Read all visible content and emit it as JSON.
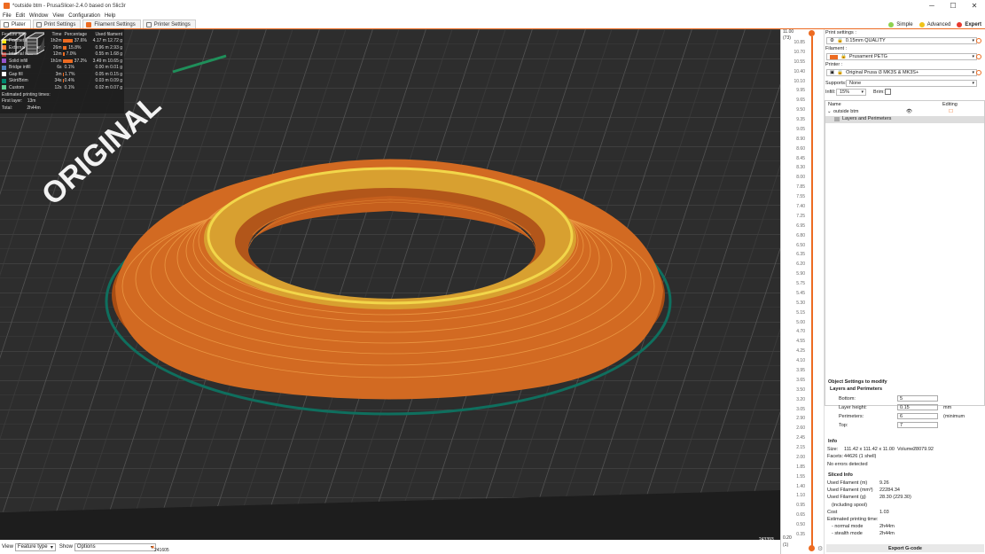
{
  "window": {
    "title": "*outside btm - PrusaSlicer-2.4.0 based on Slic3r",
    "controls": [
      "─",
      "☐",
      "✕"
    ]
  },
  "menu": [
    "File",
    "Edit",
    "Window",
    "View",
    "Configuration",
    "Help"
  ],
  "tabs": [
    {
      "label": "Plater"
    },
    {
      "label": "Print Settings"
    },
    {
      "label": "Filament Settings"
    },
    {
      "label": "Printer Settings"
    }
  ],
  "modes": [
    {
      "label": "Simple",
      "color": "#8fd14f"
    },
    {
      "label": "Advanced",
      "color": "#f0c419"
    },
    {
      "label": "Expert",
      "color": "#e83a2f"
    }
  ],
  "bed_text": "ORIGINAL",
  "legend": {
    "headers": [
      "Feature type",
      "Time",
      "Percentage",
      "Used filament"
    ],
    "rows": [
      {
        "name": "Perimeter",
        "time": "1h2m",
        "pct": "37.6%",
        "pct_value": 37.6,
        "used": "4.17 m  12.72 g",
        "color": "#ffe600"
      },
      {
        "name": "External perimeter",
        "time": "26m",
        "pct": "15.8%",
        "pct_value": 15.8,
        "used": "0.96 m  2.93 g",
        "color": "#ff7d38"
      },
      {
        "name": "Internal infill",
        "time": "12m",
        "pct": "7.0%",
        "pct_value": 7.0,
        "used": "0.55 m  1.68 g",
        "color": "#b03029"
      },
      {
        "name": "Solid infill",
        "time": "1h1m",
        "pct": "37.2%",
        "pct_value": 37.2,
        "used": "3.49 m  10.65 g",
        "color": "#9654cc"
      },
      {
        "name": "Bridge infill",
        "time": "6s",
        "pct": "0.1%",
        "pct_value": 0.1,
        "used": "0.00 m  0.01 g",
        "color": "#4d80ba"
      },
      {
        "name": "Gap fill",
        "time": "3m",
        "pct": "1.7%",
        "pct_value": 1.7,
        "used": "0.05 m  0.15 g",
        "color": "#ffffff"
      },
      {
        "name": "Skirt/Brim",
        "time": "34s",
        "pct": "0.4%",
        "pct_value": 0.4,
        "used": "0.03 m  0.09 g",
        "color": "#00876e"
      },
      {
        "name": "Custom",
        "time": "12s",
        "pct": "0.1%",
        "pct_value": 0.1,
        "used": "0.02 m  0.07 g",
        "color": "#5ed194"
      }
    ],
    "est_title": "Estimated printing times:",
    "first_layer_label": "First layer:",
    "first_layer": "13m",
    "total_label": "Total:",
    "total": "2h44m"
  },
  "bottom": {
    "view_label": "View",
    "view_value": "Feature type",
    "show_label": "Show",
    "show_value": "Options"
  },
  "hslider": {
    "left_value": "241605",
    "right_value": "243393"
  },
  "vslider": {
    "top_value": "11.00",
    "top_layer": "(73)",
    "bottom_value": "0.20",
    "bottom_layer": "(1)",
    "ticks": [
      "10.85",
      "10.70",
      "10.55",
      "10.40",
      "10.10",
      "9.95",
      "9.65",
      "9.50",
      "9.35",
      "9.05",
      "8.90",
      "8.60",
      "8.45",
      "8.30",
      "8.00",
      "7.85",
      "7.55",
      "7.40",
      "7.25",
      "6.95",
      "6.80",
      "6.50",
      "6.35",
      "6.20",
      "5.90",
      "5.75",
      "5.45",
      "5.30",
      "5.15",
      "5.00",
      "4.70",
      "4.55",
      "4.25",
      "4.10",
      "3.95",
      "3.65",
      "3.50",
      "3.20",
      "3.05",
      "2.90",
      "2.60",
      "2.45",
      "2.15",
      "2.00",
      "1.85",
      "1.55",
      "1.40",
      "1.10",
      "0.95",
      "0.65",
      "0.50",
      "0.35"
    ]
  },
  "panel": {
    "print_settings_label": "Print settings :",
    "print_settings_value": "0.15mm QUALITY",
    "filament_label": "Filament :",
    "filament_value": "Prusament PETG",
    "printer_label": "Printer :",
    "printer_value": "Original Prusa i3 MK3S & MK3S+",
    "supports_label": "Supports:",
    "supports_value": "None",
    "infill_label": "Infill:",
    "infill_value": "15%",
    "brim_label": "Brim:",
    "list_col_name": "Name",
    "list_col_editing": "Editing",
    "object_name": "outside btm",
    "object_sub": "Layers and Perimeters",
    "obj_settings_title": "Object Settings to modify",
    "obj_settings_group": "Layers and Perimeters",
    "settings": [
      {
        "label": "Bottom:",
        "value": "5",
        "unit": ""
      },
      {
        "label": "Layer height:",
        "value": "0.15",
        "unit": "mm"
      },
      {
        "label": "Perimeters:",
        "value": "6",
        "unit": "(minimum"
      },
      {
        "label": "Top:",
        "value": "7",
        "unit": ""
      }
    ],
    "info_title": "Info",
    "size_label": "Size:",
    "size_value": "111.42 x 111.42 x 11.00",
    "volume_label": "Volume:",
    "volume_value": "28079.92",
    "facets_label": "Facets:",
    "facets_value": "44626 (1 shell)",
    "errors": "No errors detected",
    "sliced_title": "Sliced Info",
    "sliced": [
      {
        "label": "Used Filament (m)",
        "value": "9.26"
      },
      {
        "label": "Used Filament (mm³)",
        "value": "22284.34"
      },
      {
        "label": "Used Filament (g)",
        "value": "28.30 (229.30)"
      },
      {
        "label": "(including spool)",
        "value": ""
      },
      {
        "label": "Cost",
        "value": "1.03"
      },
      {
        "label": "Estimated printing time:",
        "value": ""
      },
      {
        "label": "- normal mode",
        "value": "2h44m"
      },
      {
        "label": "- stealth mode",
        "value": "2h44m"
      }
    ],
    "export_label": "Export G-code"
  }
}
